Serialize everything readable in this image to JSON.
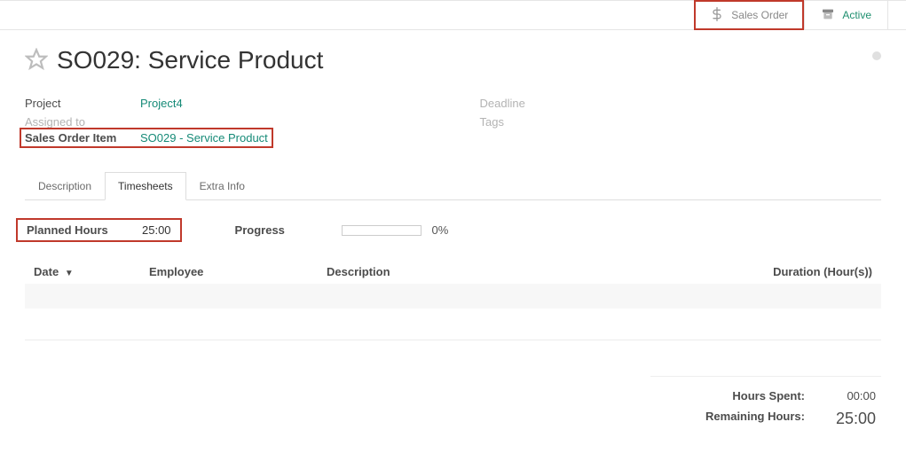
{
  "topbar": {
    "sales_order_label": "Sales Order",
    "active_label": "Active"
  },
  "title": "SO029: Service Product",
  "fields_left": {
    "project": {
      "label": "Project",
      "value": "Project4"
    },
    "assigned_to": {
      "label": "Assigned to",
      "value": ""
    },
    "sales_order_item": {
      "label": "Sales Order Item",
      "value": "SO029 - Service Product"
    }
  },
  "fields_right": {
    "deadline": {
      "label": "Deadline",
      "value": ""
    },
    "tags": {
      "label": "Tags",
      "value": ""
    }
  },
  "tabs": {
    "description": "Description",
    "timesheets": "Timesheets",
    "extra_info": "Extra Info"
  },
  "timesheet": {
    "planned_hours": {
      "label": "Planned Hours",
      "value": "25:00"
    },
    "progress": {
      "label": "Progress",
      "pct": "0%"
    },
    "columns": {
      "date": "Date",
      "employee": "Employee",
      "description": "Description",
      "duration": "Duration (Hour(s))"
    },
    "rows": []
  },
  "totals": {
    "hours_spent": {
      "label": "Hours Spent:",
      "value": "00:00"
    },
    "remaining_hours": {
      "label": "Remaining Hours:",
      "value": "25:00"
    }
  }
}
